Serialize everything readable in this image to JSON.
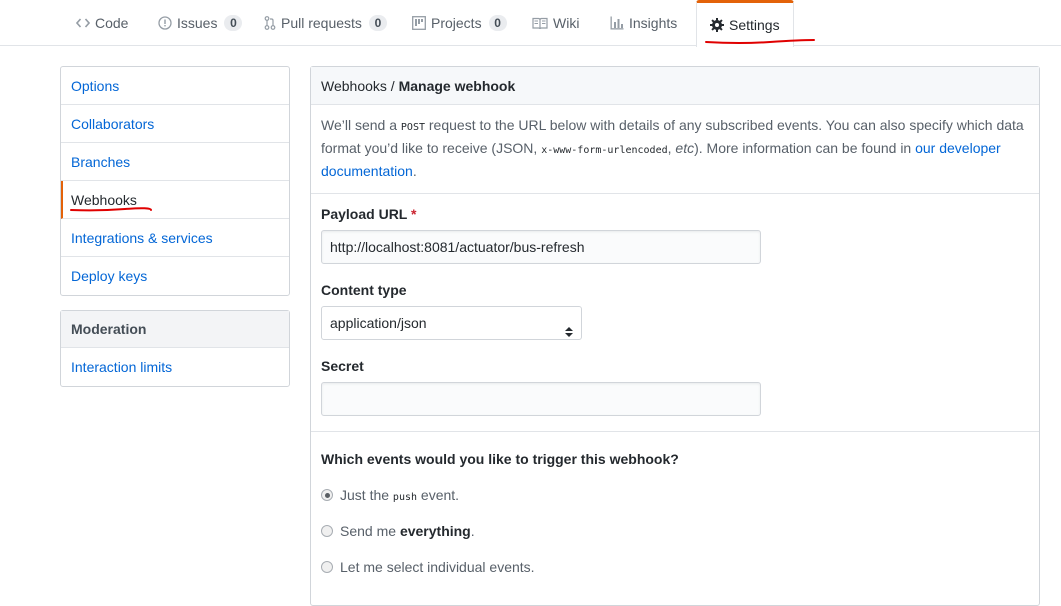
{
  "nav": {
    "tabs": [
      {
        "label": "Code",
        "icon": "code-icon"
      },
      {
        "label": "Issues",
        "count": "0",
        "icon": "issue-icon"
      },
      {
        "label": "Pull requests",
        "count": "0",
        "icon": "pull-request-icon"
      },
      {
        "label": "Projects",
        "count": "0",
        "icon": "project-icon"
      },
      {
        "label": "Wiki",
        "icon": "book-icon"
      },
      {
        "label": "Insights",
        "icon": "graph-icon"
      },
      {
        "label": "Settings",
        "icon": "gear-icon",
        "selected": true
      }
    ]
  },
  "sidebar": {
    "items": [
      "Options",
      "Collaborators",
      "Branches",
      "Webhooks",
      "Integrations & services",
      "Deploy keys"
    ],
    "selected": "Webhooks",
    "moderation": {
      "heading": "Moderation",
      "items": [
        "Interaction limits"
      ]
    }
  },
  "panel": {
    "breadcrumb_parent": "Webhooks",
    "breadcrumb_sep": " / ",
    "breadcrumb_current": "Manage webhook",
    "desc": {
      "p1": "We’ll send a ",
      "code1": "POST",
      "p2": " request to the URL below with details of any subscribed events. You can also specify which data format you’d like to receive (JSON, ",
      "code2": "x-www-form-urlencoded",
      "p3": ", ",
      "em": "etc",
      "p4": "). More information can be found in ",
      "link": "our developer documentation",
      "p5": "."
    },
    "payload_url": {
      "label": "Payload URL",
      "required": "*",
      "value": "http://localhost:8081/actuator/bus-refresh"
    },
    "content_type": {
      "label": "Content type",
      "value": "application/json"
    },
    "secret": {
      "label": "Secret",
      "value": ""
    },
    "events": {
      "question": "Which events would you like to trigger this webhook?",
      "options": [
        {
          "pre": "Just the ",
          "code": "push",
          "post": " event.",
          "checked": true
        },
        {
          "pre": "Send me ",
          "bold": "everything",
          "post": ".",
          "checked": false
        },
        {
          "pre": "Let me select individual events.",
          "checked": false
        }
      ]
    }
  },
  "colors": {
    "accent": "#e36209",
    "link": "#0366d6",
    "annotation": "#e00000"
  }
}
